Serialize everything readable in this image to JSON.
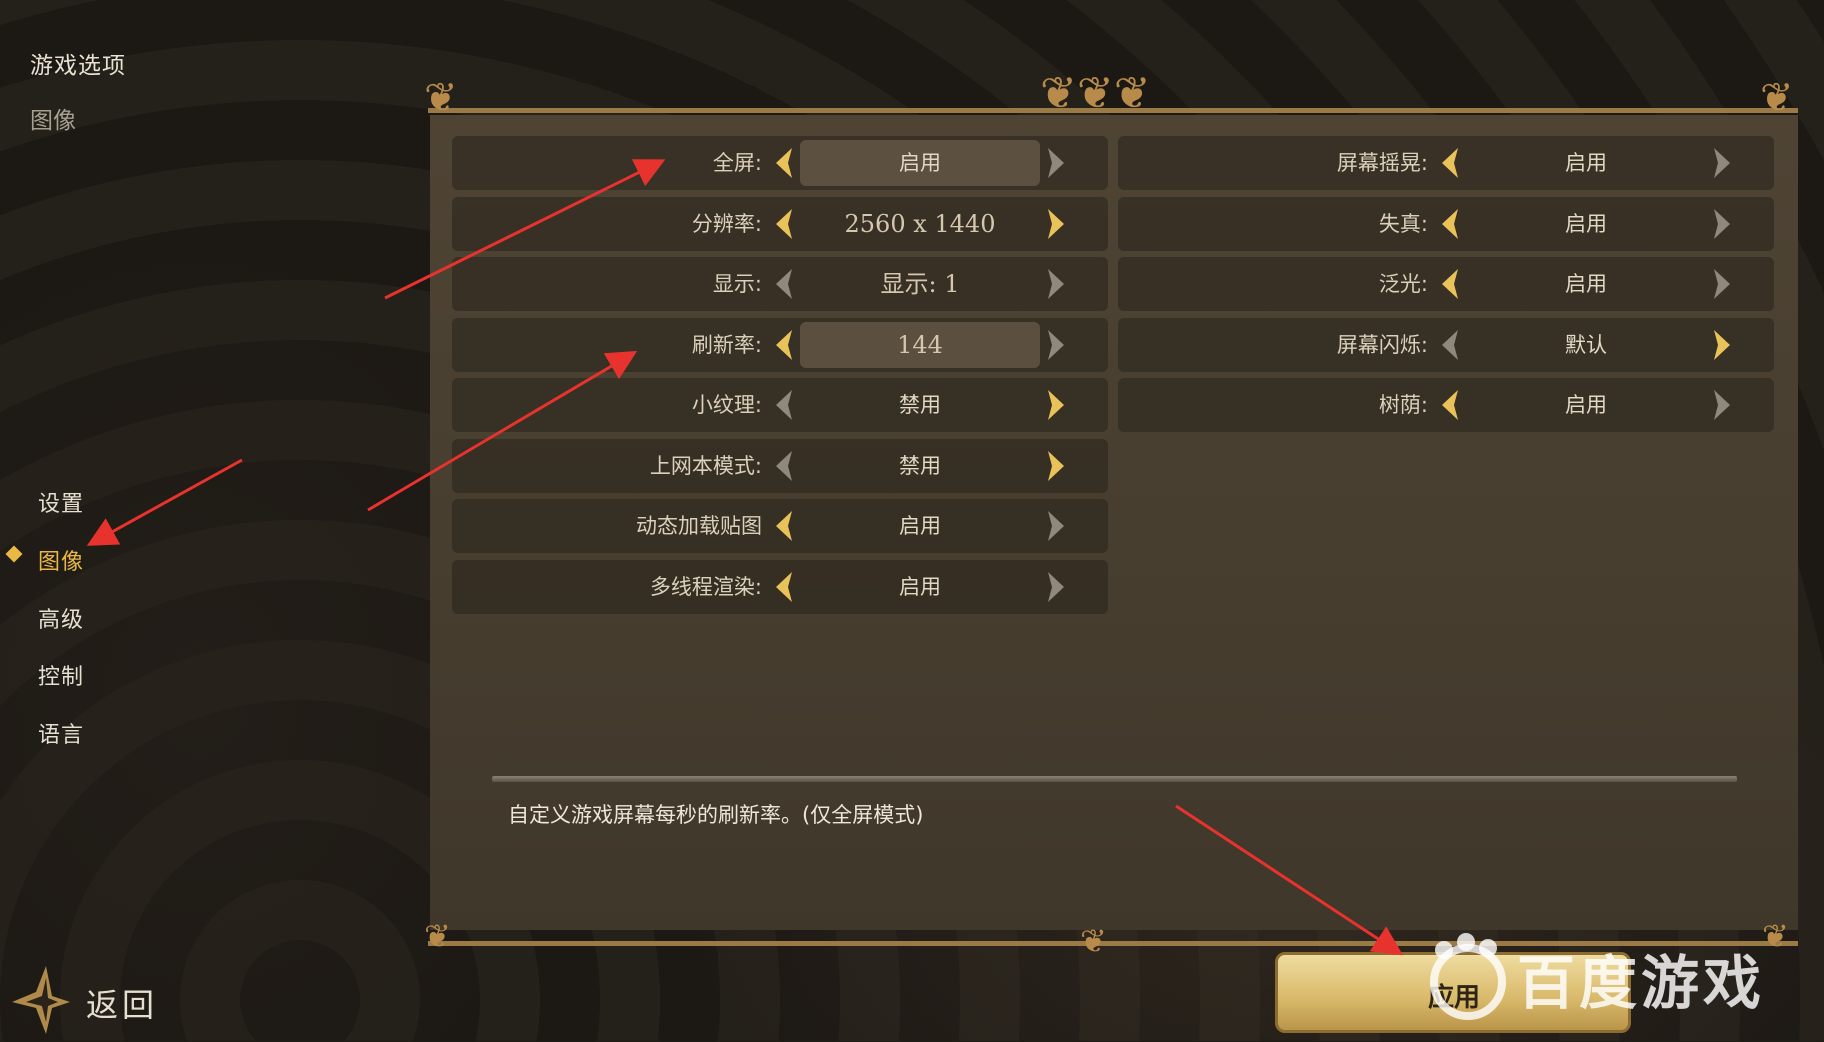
{
  "breadcrumb": {
    "title": "游戏选项",
    "current": "图像"
  },
  "nav": {
    "items": [
      {
        "label": "设置",
        "active": false
      },
      {
        "label": "图像",
        "active": true
      },
      {
        "label": "高级",
        "active": false
      },
      {
        "label": "控制",
        "active": false
      },
      {
        "label": "语言",
        "active": false
      }
    ]
  },
  "settings_left": [
    {
      "label": "全屏:",
      "value": "启用"
    },
    {
      "label": "分辨率:",
      "value": "2560 x 1440"
    },
    {
      "label": "显示:",
      "value": "显示: 1"
    },
    {
      "label": "刷新率:",
      "value": "144"
    },
    {
      "label": "小纹理:",
      "value": "禁用"
    },
    {
      "label": "上网本模式:",
      "value": "禁用"
    },
    {
      "label": "动态加载贴图",
      "value": "启用"
    },
    {
      "label": "多线程渲染:",
      "value": "启用"
    }
  ],
  "settings_right": [
    {
      "label": "屏幕摇晃:",
      "value": "启用"
    },
    {
      "label": "失真:",
      "value": "启用"
    },
    {
      "label": "泛光:",
      "value": "启用"
    },
    {
      "label": "屏幕闪烁:",
      "value": "默认"
    },
    {
      "label": "树荫:",
      "value": "启用"
    }
  ],
  "description": "自定义游戏屏幕每秒的刷新率。(仅全屏模式)",
  "buttons": {
    "back": "返回",
    "apply": "应用"
  },
  "watermark": {
    "text": "百度游戏"
  },
  "colors": {
    "accent": "#e9b944",
    "arrow_active": "#e9c25a",
    "arrow_inactive": "#8f887c",
    "annotation": "#e8322e"
  },
  "icons": {
    "left_arrow": "chevron-left-icon",
    "right_arrow": "chevron-right-icon",
    "back": "back-arrow-icon",
    "watermark_logo": "paw-logo-icon"
  }
}
